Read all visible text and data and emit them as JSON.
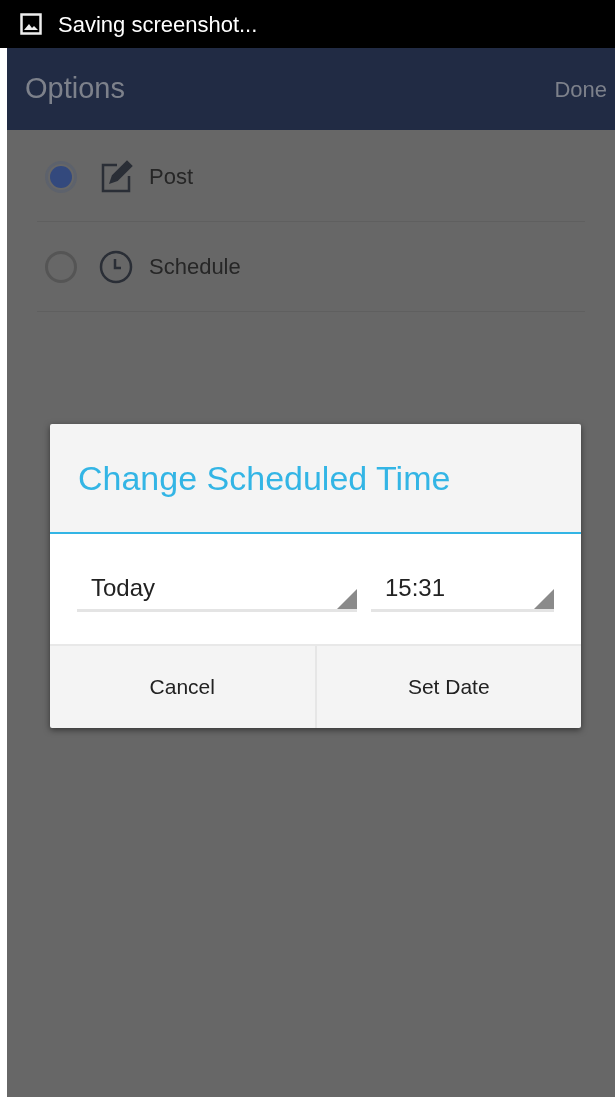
{
  "status_bar": {
    "notification": "Saving screenshot..."
  },
  "action_bar": {
    "title": "Options",
    "action": "Done"
  },
  "options": [
    {
      "kind": "post",
      "label": "Post",
      "selected": true
    },
    {
      "kind": "schedule",
      "label": "Schedule",
      "selected": false
    }
  ],
  "dialog": {
    "title": "Change Scheduled Time",
    "spinners": [
      {
        "value": "Today"
      },
      {
        "value": "15:31"
      }
    ],
    "buttons": [
      "Cancel",
      "Set Date"
    ]
  }
}
